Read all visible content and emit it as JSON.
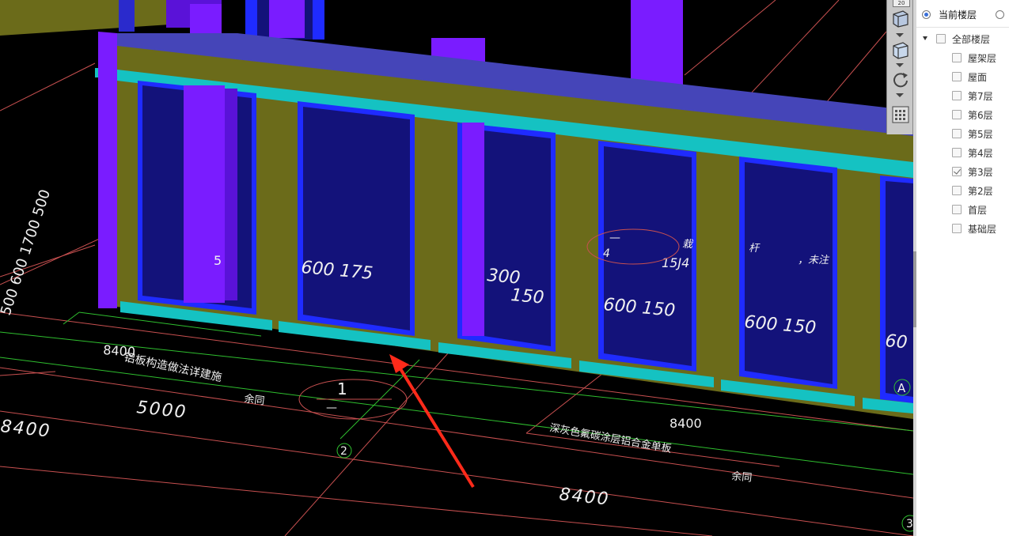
{
  "viewport": {
    "dimensions": {
      "top": "8400",
      "left_vertical": "500 600 1700 500",
      "left_bottom": "8400",
      "bay": "5000",
      "right_top": "8400",
      "bottom": "8400",
      "window_1": "600 175",
      "window_2": "300",
      "window_3": "150",
      "window_4": "600 150",
      "window_5": "600 150",
      "window_6": "60",
      "detail_ref": "15J4",
      "detail_num": "4"
    },
    "annotations": {
      "left_note": "铝板构造做法详建施",
      "left_same": "余同",
      "right_note": "深灰色氟碳涂层铝合金单板",
      "right_same": "余同",
      "frag_a": "杆",
      "frag_b": "，未注",
      "frag_c": "栽"
    },
    "grid_bubbles": {
      "g1": "1",
      "g2": "2",
      "gA": "A",
      "g3": "3"
    },
    "colors": {
      "beam": "#6b6b1a",
      "column": "#7a1cff",
      "glass": "#13127a",
      "frame": "#1f2bff",
      "sill": "#15c2c2",
      "arrow": "#ff2a1a"
    }
  },
  "toolbar": {
    "zoom_label": "20",
    "tools": [
      "cube-view-icon",
      "cube-wire-icon",
      "rotate-icon",
      "dynamic-observe-icon"
    ]
  },
  "floor_panel": {
    "mode_current": "当前楼层",
    "mode_all_selected": true,
    "tree": [
      {
        "label": "全部楼层",
        "checked": false,
        "level": 0
      },
      {
        "label": "屋架层",
        "checked": false,
        "level": 1
      },
      {
        "label": "屋面",
        "checked": false,
        "level": 1
      },
      {
        "label": "第7层",
        "checked": false,
        "level": 1
      },
      {
        "label": "第6层",
        "checked": false,
        "level": 1
      },
      {
        "label": "第5层",
        "checked": false,
        "level": 1
      },
      {
        "label": "第4层",
        "checked": false,
        "level": 1
      },
      {
        "label": "第3层",
        "checked": true,
        "level": 1
      },
      {
        "label": "第2层",
        "checked": false,
        "level": 1
      },
      {
        "label": "首层",
        "checked": false,
        "level": 1
      },
      {
        "label": "基础层",
        "checked": false,
        "level": 1
      }
    ]
  }
}
